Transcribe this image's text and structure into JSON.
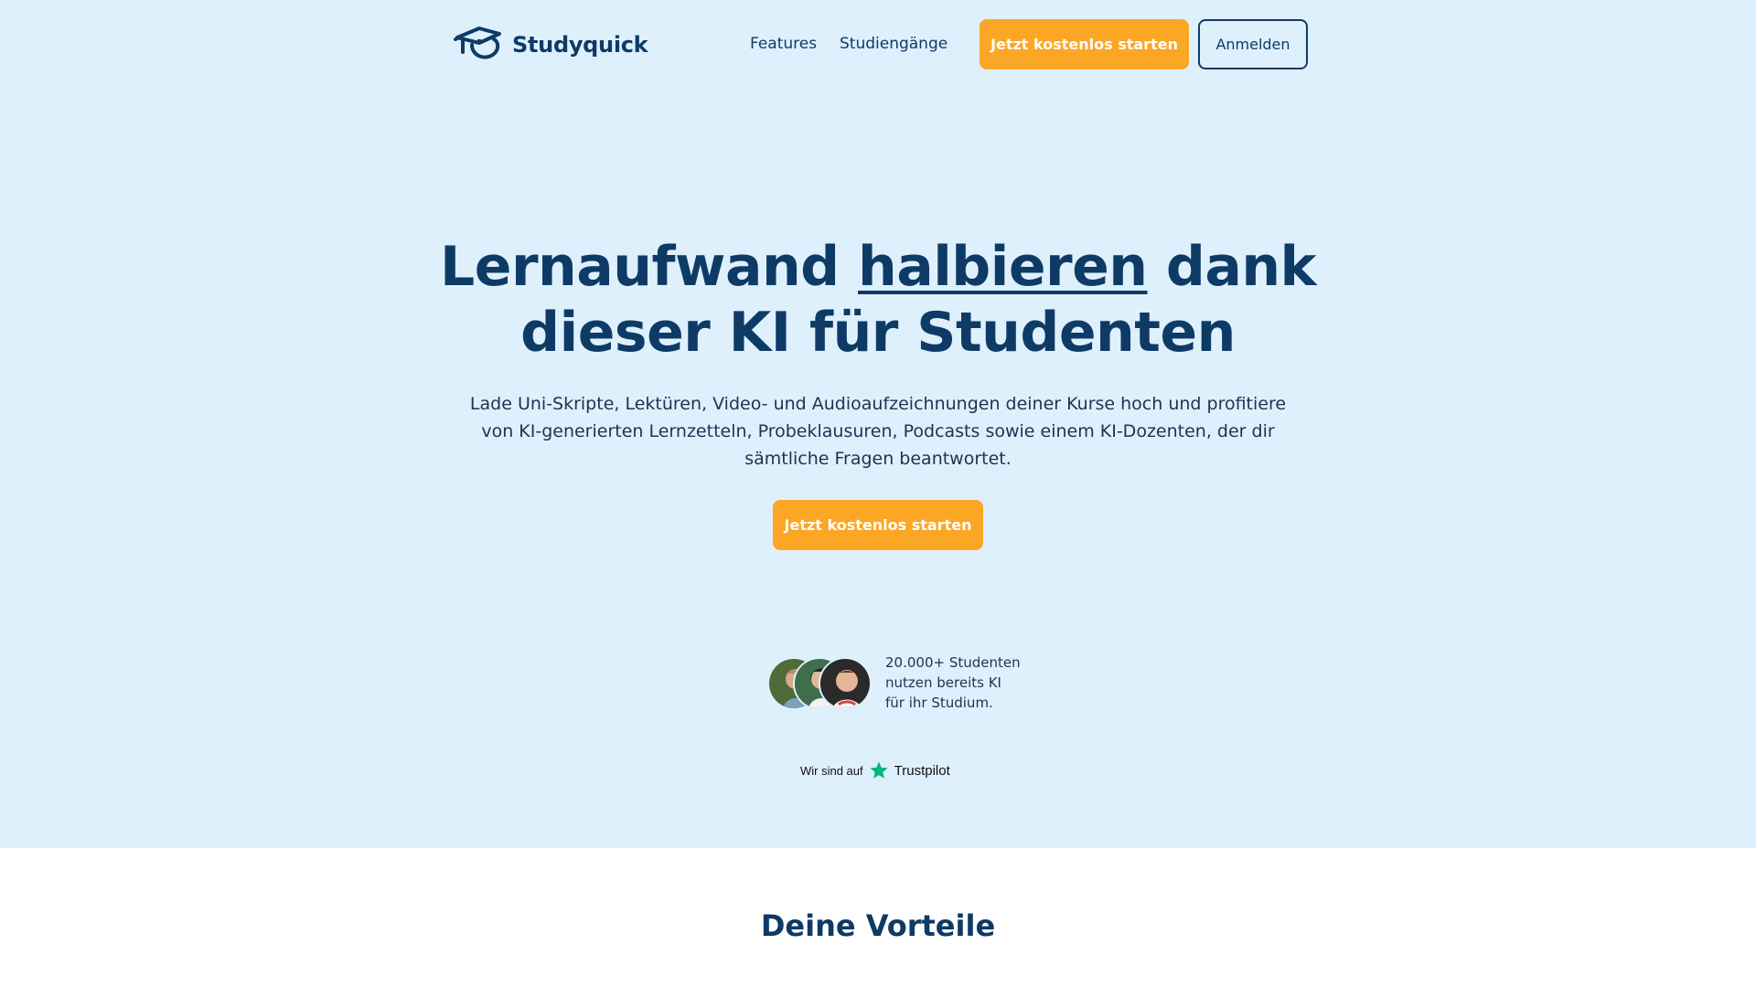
{
  "header": {
    "brand": "Studyquick",
    "nav": [
      {
        "label": "Features"
      },
      {
        "label": "Studiengänge"
      }
    ],
    "cta_label": "Jetzt kostenlos starten",
    "login_label": "Anmelden"
  },
  "hero": {
    "headline_part1": "Lernaufwand ",
    "headline_highlight": "halbieren",
    "headline_part2": " dank",
    "headline_line2": "dieser KI für Studenten",
    "subtext": "Lade Uni-Skripte, Lektüren, Video- und Audioaufzeichnungen deiner Kurse hoch und profitiere von KI-generierten Lernzetteln, Probeklausuren, Podcasts sowie einem KI-Dozenten, der dir sämtliche Fragen beantwortet.",
    "cta_label": "Jetzt kostenlos starten"
  },
  "social_proof": {
    "line1": "20.000+ Studenten",
    "line2": "nutzen bereits KI",
    "line3": "für ihr Studium.",
    "trustpilot_prefix": "Wir sind auf",
    "trustpilot_brand": "Trustpilot"
  },
  "benefits": {
    "title": "Deine Vorteile"
  },
  "colors": {
    "hero_bg": "#dff0fd",
    "primary_text": "#0e3b66",
    "accent_orange": "#fca625",
    "trustpilot_green": "#00b67a"
  }
}
